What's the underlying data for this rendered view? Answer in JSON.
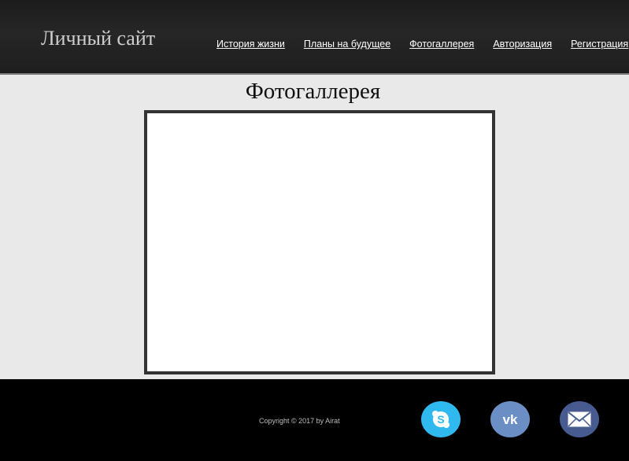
{
  "header": {
    "logo": "Личный сайт",
    "nav": [
      {
        "label": "История жизни"
      },
      {
        "label": "Планы на будущее"
      },
      {
        "label": "Фотогаллерея"
      },
      {
        "label": "Авторизация"
      },
      {
        "label": "Регистрация"
      }
    ]
  },
  "main": {
    "title": "Фотогаллерея"
  },
  "footer": {
    "copyright": "Copyright © 2017 by Airat",
    "social": [
      {
        "icon": "skype-icon",
        "color": "#2fb9ef"
      },
      {
        "icon": "vk-icon",
        "color": "#6b8fc4"
      },
      {
        "icon": "mail-icon",
        "color": "#475b91"
      }
    ]
  },
  "colors": {
    "header_bg": "#1e1e1e",
    "page_bg": "#e9e9e9",
    "footer_bg": "#000000",
    "frame_border": "#333333"
  }
}
